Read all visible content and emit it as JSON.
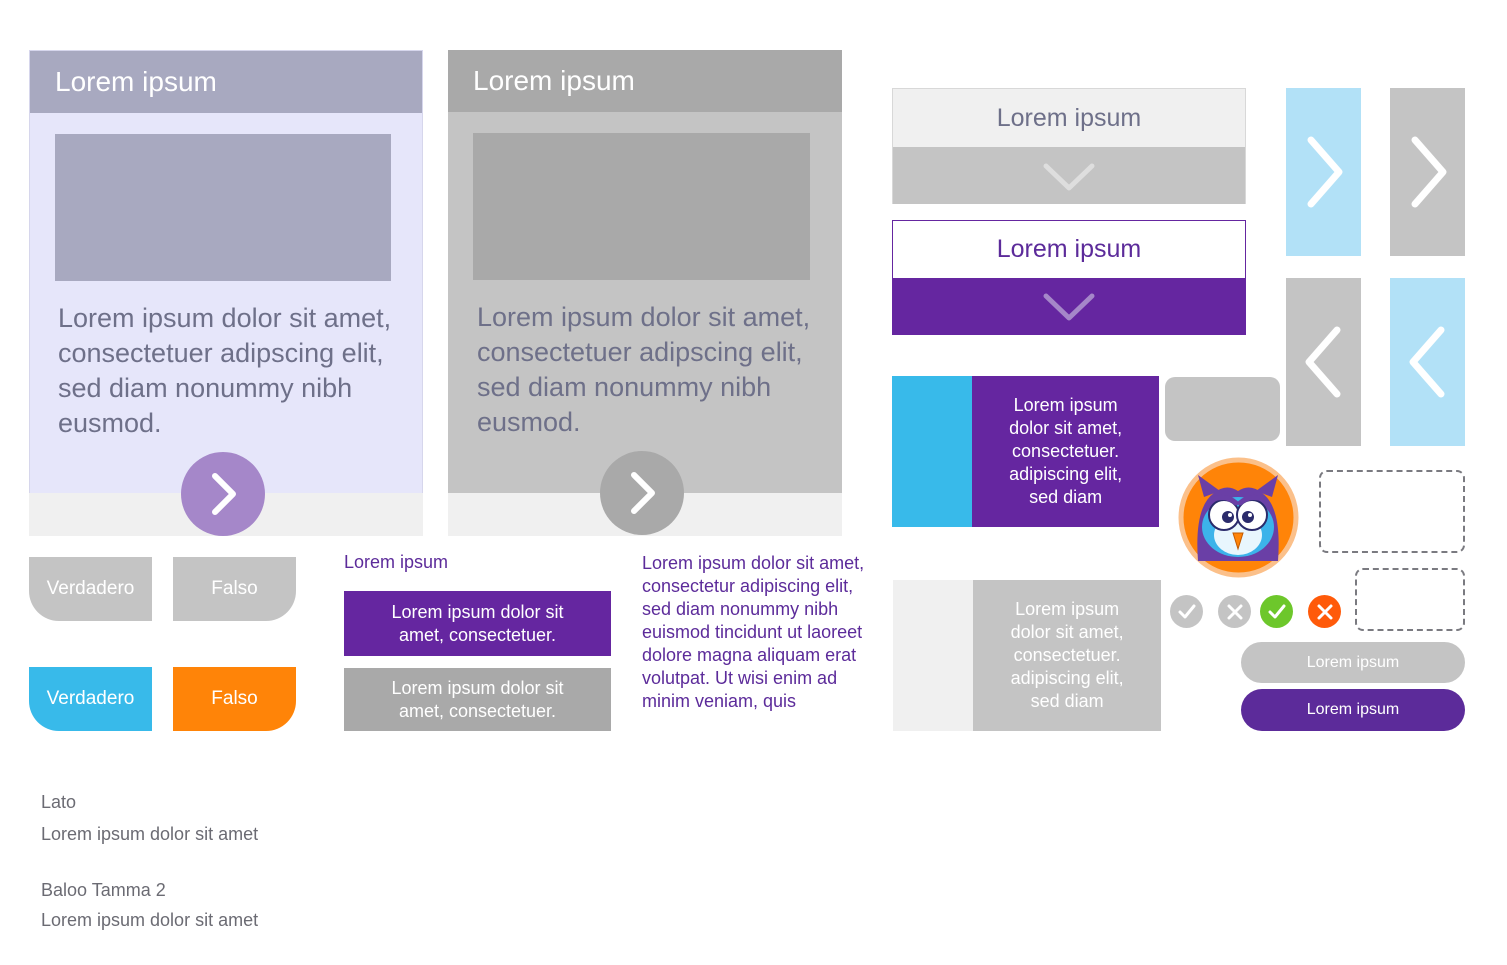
{
  "cards": [
    {
      "title": "Lorem ipsum",
      "body": "Lorem ipsum dolor sit amet, consectetuer adipscing elit, sed diam nonummy nibh eusmod.",
      "header_color": "#a8a9c0",
      "bg_color": "#e6e6fa",
      "image_color": "#a8a9c0",
      "text_color": "#6e7089",
      "button_color": "#a587c9",
      "button_icon": "chevron-right-icon"
    },
    {
      "title": "Lorem ipsum",
      "body": "Lorem ipsum dolor sit amet, consectetuer adipscing elit, sed diam nonummy nibh eusmod.",
      "header_color": "#a9a9a9",
      "bg_color": "#c4c4c4",
      "image_color": "#a9a9a9",
      "text_color": "#6e7089",
      "button_color": "#a9a9a9",
      "button_icon": "chevron-right-icon"
    }
  ],
  "toggles": {
    "neutral": {
      "true_label": "Verdadero",
      "false_label": "Falso",
      "color": "#c4c4c4"
    },
    "active": {
      "true_label": "Verdadero",
      "false_label": "Falso",
      "true_color": "#38baea",
      "false_color": "#ff8408"
    }
  },
  "middle": {
    "small_title": "Lorem ipsum",
    "purple_button": "Lorem ipsum dolor sit amet, consectetuer.",
    "gray_button": "Lorem ipsum dolor sit amet, consectetuer.",
    "paragraph": "Lorem ipsum dolor sit amet, consectetur adipiscing elit, sed diam nonummy nibh euismod tincidunt ut  laoreet dolore magna aliquam erat volutpat. Ut wisi enim ad minim veniam, quis"
  },
  "accordions": [
    {
      "label": "Lorem ipsum",
      "state": "inactive",
      "icon": "chevron-down-icon"
    },
    {
      "label": "Lorem ipsum",
      "state": "active",
      "icon": "chevron-down-icon"
    }
  ],
  "arrow_tiles": [
    {
      "icon": "chevron-right-icon",
      "color": "#b2e1f7"
    },
    {
      "icon": "chevron-right-icon",
      "color": "#c4c4c4"
    },
    {
      "icon": "chevron-left-icon",
      "color": "#c4c4c4"
    },
    {
      "icon": "chevron-left-icon",
      "color": "#b2e1f7"
    }
  ],
  "info_cards": [
    {
      "text": "Lorem ipsum dolor sit amet, consectetuer. adipiscing elit, sed diam",
      "state": "active"
    },
    {
      "text": "Lorem ipsum dolor sit amet, consectetuer. adipiscing elit, sed diam",
      "state": "inactive"
    }
  ],
  "mascot": {
    "icon": "owl-mascot-icon"
  },
  "feedback_icons": [
    {
      "icon": "check-icon",
      "color": "#c4c4c4"
    },
    {
      "icon": "close-icon",
      "color": "#c4c4c4"
    },
    {
      "icon": "check-icon",
      "color": "#6dc72b"
    },
    {
      "icon": "close-icon",
      "color": "#ff5a0a"
    }
  ],
  "round_buttons": [
    {
      "label": "Lorem ipsum",
      "color": "#c4c4c4"
    },
    {
      "label": "Lorem ipsum",
      "color": "#5c2b9a"
    }
  ],
  "typography": [
    {
      "name": "Lato",
      "sample": "Lorem ipsum dolor sit amet"
    },
    {
      "name": "Baloo Tamma 2",
      "sample": "Lorem ipsum dolor sit amet"
    }
  ]
}
